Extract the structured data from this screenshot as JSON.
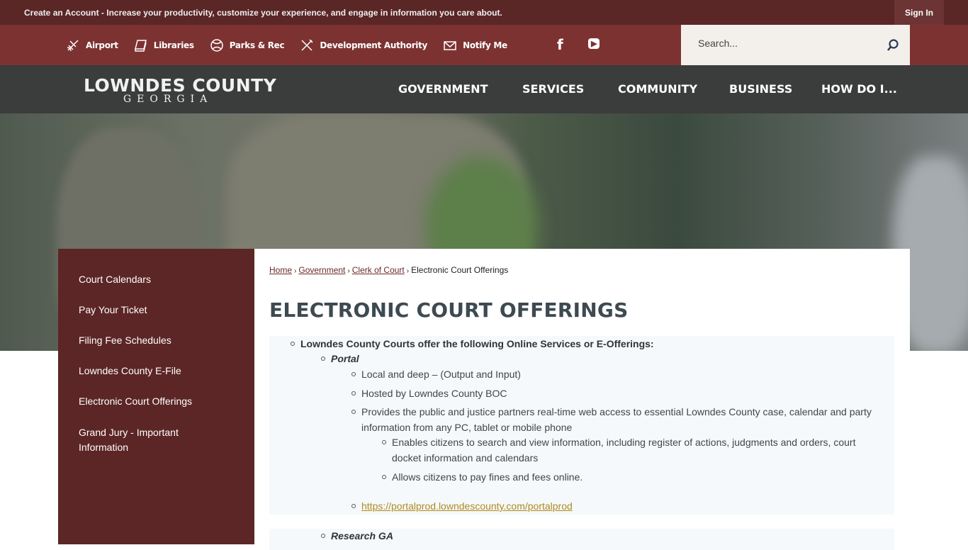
{
  "topbar": {
    "message": "Create an Account - Increase your productivity, customize your experience, and engage in information you care about.",
    "sign_in": "Sign In"
  },
  "quick_links": [
    {
      "label": "Airport",
      "icon": "airplane-icon"
    },
    {
      "label": "Libraries",
      "icon": "book-icon"
    },
    {
      "label": "Parks & Rec",
      "icon": "ball-icon"
    },
    {
      "label": "Development Authority",
      "icon": "tools-icon"
    },
    {
      "label": "Notify Me",
      "icon": "envelope-icon"
    }
  ],
  "social": {
    "facebook": "f",
    "youtube": "▶"
  },
  "search": {
    "placeholder": "Search..."
  },
  "logo": {
    "line1": "LOWNDES COUNTY",
    "line2": "GEORGIA"
  },
  "menu": [
    "GOVERNMENT",
    "SERVICES",
    "COMMUNITY",
    "BUSINESS",
    "HOW DO I..."
  ],
  "sidebar": [
    "Court Calendars",
    "Pay Your Ticket",
    "Filing Fee Schedules",
    "Lowndes County E-File",
    "Electronic Court Offerings",
    "Grand Jury - Important Information"
  ],
  "breadcrumb": [
    "Home",
    "Government",
    "Clerk of Court",
    "Electronic Court Offerings"
  ],
  "page_title": "ELECTRONIC COURT OFFERINGS",
  "content": {
    "intro": "Lowndes County Courts offer the following Online Services or E-Offerings:",
    "portal": "Portal",
    "p1": "Local and deep – (Output and Input)",
    "p2": "Hosted by Lowndes County BOC",
    "p3": "Provides the public and justice partners real-time web access to essential Lowndes County case, calendar and party information from any PC, tablet or mobile phone",
    "p3a": "Enables citizens to search and view information, including register of actions, judgments and orders, court docket information and calendars",
    "p3b": "Allows citizens to pay fines and fees online.",
    "portal_link": "https://portalprod.lowndescounty.com/portalprod",
    "research": "Research GA"
  },
  "colors": {
    "topbar": "#5b2626",
    "utility": "#7d3232",
    "nav": "#3b3c3c",
    "sidebar": "#5c2626",
    "title": "#3e4a52",
    "link": "#b08a1c"
  }
}
